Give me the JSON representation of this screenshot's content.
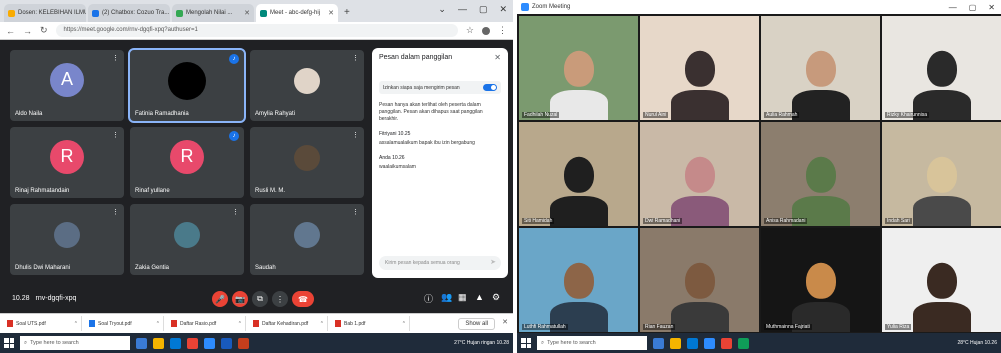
{
  "left": {
    "tabs": [
      {
        "label": "Dosen: KELEBIHAN ILMU ...",
        "color": "#f9ab00"
      },
      {
        "label": "(2) Chatbox: Cozuo Tra...",
        "color": "#1a73e8"
      },
      {
        "label": "Mengolah Nilai ...",
        "color": "#34a853"
      },
      {
        "label": "Meet - abc-defg-hij",
        "color": "#00897b"
      }
    ],
    "new_tab": "+",
    "window_controls": [
      "⌄",
      "—",
      "▢",
      "✕"
    ],
    "url": "https://meet.google.com/rnv-dgqfi-xpq?authuser=1",
    "participants": [
      {
        "name": "Aldo Naila",
        "initial": "A",
        "color": "#7986cb"
      },
      {
        "name": "Fatinia Ramadhania",
        "initial": "",
        "color": "#000000"
      },
      {
        "name": "Amylia Rahyati",
        "initial": "",
        "color": "#e0d4c8"
      },
      {
        "name": "Rinaj Rahmatandain",
        "initial": "R",
        "color": "#e8496b"
      },
      {
        "name": "Rinaf yullane",
        "initial": "R",
        "color": "#e8496b"
      },
      {
        "name": "Rusli M. M.",
        "initial": "",
        "color": "#5a4a3a"
      },
      {
        "name": "Dhulis Dwi Maharani",
        "initial": "",
        "color": "#5b6d84"
      },
      {
        "name": "Zakia Gentia",
        "initial": "",
        "color": "#4a7a8a"
      },
      {
        "name": "Saudah",
        "initial": "",
        "color": "#61778f"
      }
    ],
    "chat": {
      "title": "Pesan dalam panggilan",
      "close": "✕",
      "toggle_label": "Izinkan siapa saja mengirim pesan",
      "info": "Pesan hanya akan terlihat oleh peserta dalam panggilan. Pesan akan dihapus saat panggilan berakhir.",
      "messages": [
        {
          "who": "Fitriyani 10.25",
          "text": "assalamualaikum bapak ibu izin bergabung"
        },
        {
          "who": "Anda 10.26",
          "text": "waalaikumsalam"
        }
      ],
      "input_placeholder": "Kirim pesan kepada semua orang",
      "send": "➤"
    },
    "bottom": {
      "time": "10.28",
      "code": "rnv-dgqfi-xpq"
    },
    "controls": [
      "🎤",
      "📷",
      "⧉",
      "⋮",
      "☎"
    ],
    "right_controls": [
      "ⓘ",
      "👥",
      "▦",
      "▲",
      "⚙"
    ],
    "downloads": [
      {
        "name": "Soal UTS.pdf",
        "blue": false
      },
      {
        "name": "Soal Tryout.pdf",
        "blue": true
      },
      {
        "name": "Daftar Rasio.pdf",
        "blue": false
      },
      {
        "name": "Daftar Kehadiran.pdf",
        "blue": false
      },
      {
        "name": "Bab 1.pdf",
        "blue": false
      }
    ],
    "show_all": "Show all",
    "taskbar_search": "Type here to search",
    "tray": "27°C  Hujan ringan   10.28"
  },
  "right": {
    "title": "Zoom Meeting",
    "window_controls": [
      "—",
      "▢",
      "✕"
    ],
    "tiles": [
      {
        "name": "Fadhilah Nuzal",
        "bg": "#7b9a6f",
        "skin": "#c99b7a",
        "cloth": "#e8e8e8"
      },
      {
        "name": "Nurul Aini",
        "bg": "#e7d8c9",
        "skin": "#3a3030",
        "cloth": "#3a3030"
      },
      {
        "name": "Aulia Rahmah",
        "bg": "#d9d2c5",
        "skin": "#c79a7c",
        "cloth": "#222222"
      },
      {
        "name": "Rizky Khairunnisa",
        "bg": "#e9e6e1",
        "skin": "#2a2a2a",
        "cloth": "#2a2a2a"
      },
      {
        "name": "Siti Hamidah",
        "bg": "#b8a88c",
        "skin": "#1f1f1f",
        "cloth": "#1f1f1f"
      },
      {
        "name": "Dwi Ramadhani",
        "bg": "#c9b9a7",
        "skin": "#c58a8a",
        "cloth": "#8a5a7a"
      },
      {
        "name": "Anisa Rahmadani",
        "bg": "#8c7e6e",
        "skin": "#5b7a4a",
        "cloth": "#5b7a4a"
      },
      {
        "name": "Indah Sari",
        "bg": "#c6b9a0",
        "skin": "#d8c49a",
        "cloth": "#4a4a4a"
      },
      {
        "name": "Luthfi Rahmatullah",
        "bg": "#6aa6c8",
        "skin": "#8d6548",
        "cloth": "#2c3e50"
      },
      {
        "name": "Rian Fauzan",
        "bg": "#8a7a6a",
        "skin": "#7d5a40",
        "cloth": "#3a3a3a"
      },
      {
        "name": "Muthmainna Fajriati",
        "bg": "#151515",
        "skin": "#c98a4a",
        "cloth": "#2a2a2a"
      },
      {
        "name": "Yulia Riza",
        "bg": "#efefef",
        "skin": "#3a2a22",
        "cloth": "#3a2a22"
      }
    ],
    "taskbar_search": "Type here to search",
    "tray": "28°C  Hujan  10.26"
  }
}
